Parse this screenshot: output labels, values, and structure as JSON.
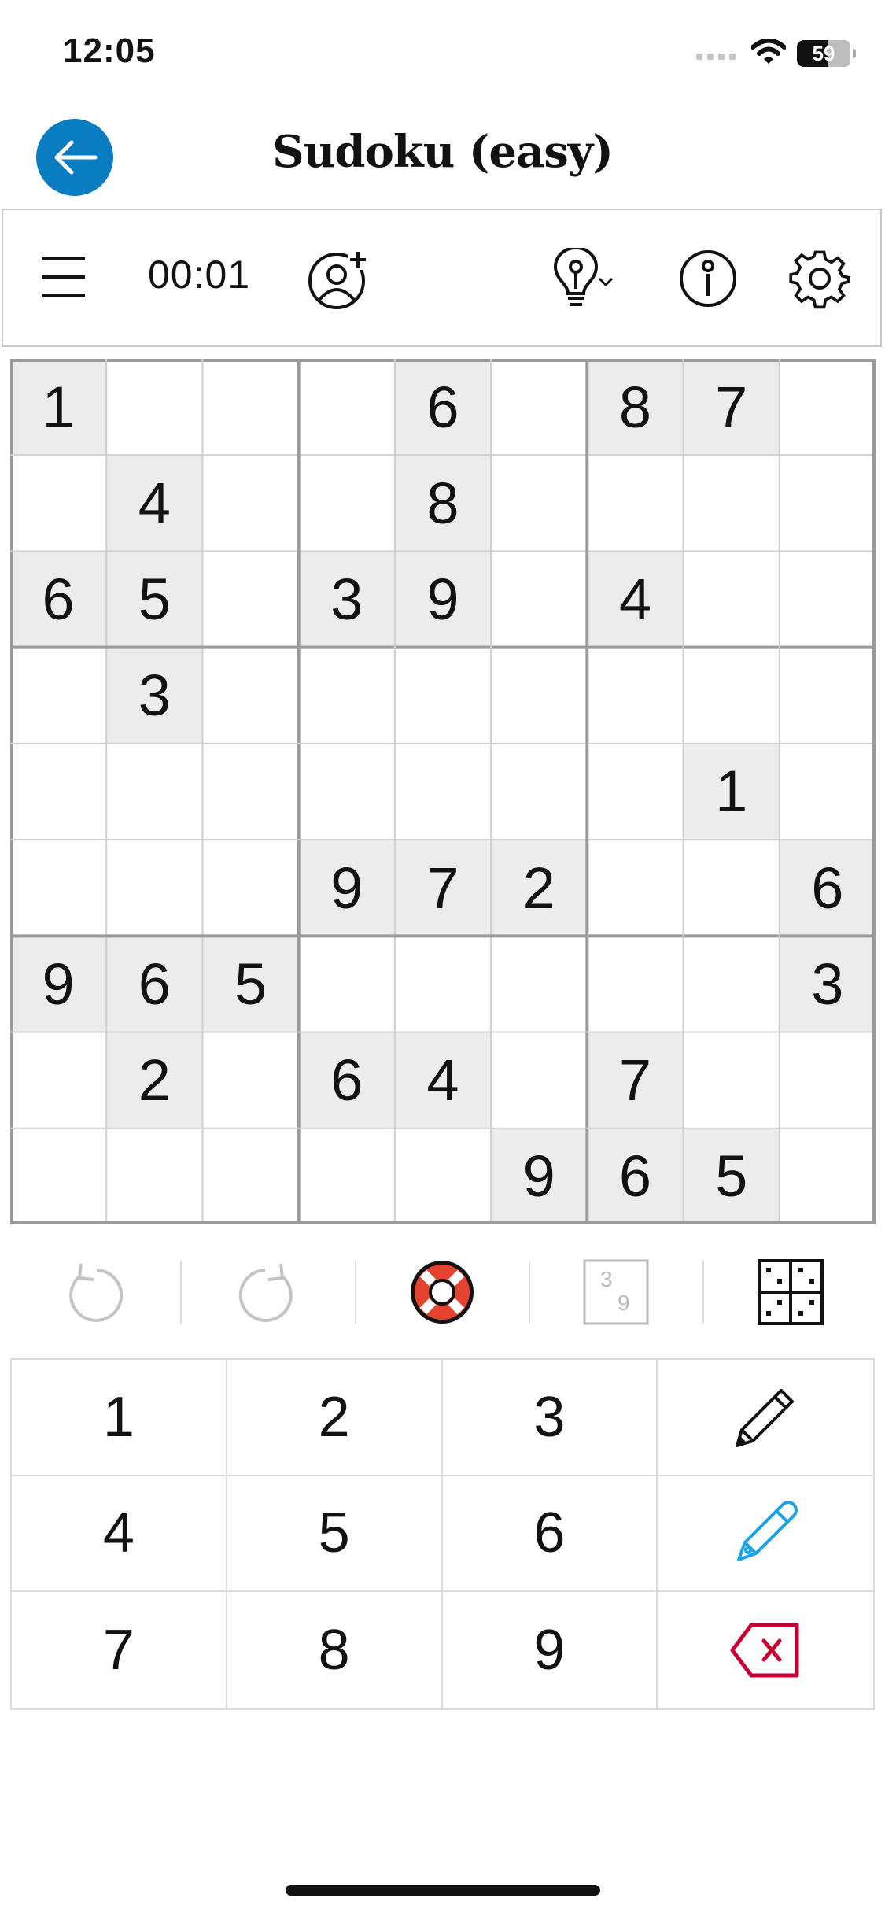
{
  "status_bar": {
    "time": "12:05",
    "battery": {
      "label": "59",
      "level_percent": 59
    }
  },
  "header": {
    "title": "Sudoku (easy)",
    "back_icon": "arrow-left-icon",
    "accent_color": "#0A7DC2"
  },
  "toolbar": {
    "timer": "00:01",
    "icons": [
      "menu-icon",
      "add-person-icon",
      "lightbulb-hint-icon",
      "chevron-down-icon",
      "info-icon",
      "gear-icon"
    ]
  },
  "board": {
    "given_background": "#ececec",
    "rows": [
      [
        1,
        0,
        0,
        0,
        6,
        0,
        8,
        7,
        0
      ],
      [
        0,
        4,
        0,
        0,
        8,
        0,
        0,
        0,
        0
      ],
      [
        6,
        5,
        0,
        3,
        9,
        0,
        4,
        0,
        0
      ],
      [
        0,
        3,
        0,
        0,
        0,
        0,
        0,
        0,
        0
      ],
      [
        0,
        0,
        0,
        0,
        0,
        0,
        0,
        1,
        0
      ],
      [
        0,
        0,
        0,
        9,
        7,
        2,
        0,
        0,
        6
      ],
      [
        9,
        6,
        5,
        0,
        0,
        0,
        0,
        0,
        3
      ],
      [
        0,
        2,
        0,
        6,
        4,
        0,
        7,
        0,
        0
      ],
      [
        0,
        0,
        0,
        0,
        0,
        9,
        6,
        5,
        0
      ]
    ]
  },
  "action_bar": {
    "icons": [
      "undo-icon",
      "redo-icon",
      "lifebuoy-icon",
      "pencil-marks-icon",
      "grid-view-icon"
    ],
    "notes_sample": [
      "3",
      "9"
    ],
    "lifebuoy_color": "#E5432F"
  },
  "keypad": {
    "numbers": [
      "1",
      "2",
      "3",
      "4",
      "5",
      "6",
      "7",
      "8",
      "9"
    ],
    "tool_icons": [
      "pencil-icon",
      "pen-icon",
      "delete-icon"
    ],
    "pen_color": "#1AA3E8",
    "delete_color": "#C70033"
  }
}
